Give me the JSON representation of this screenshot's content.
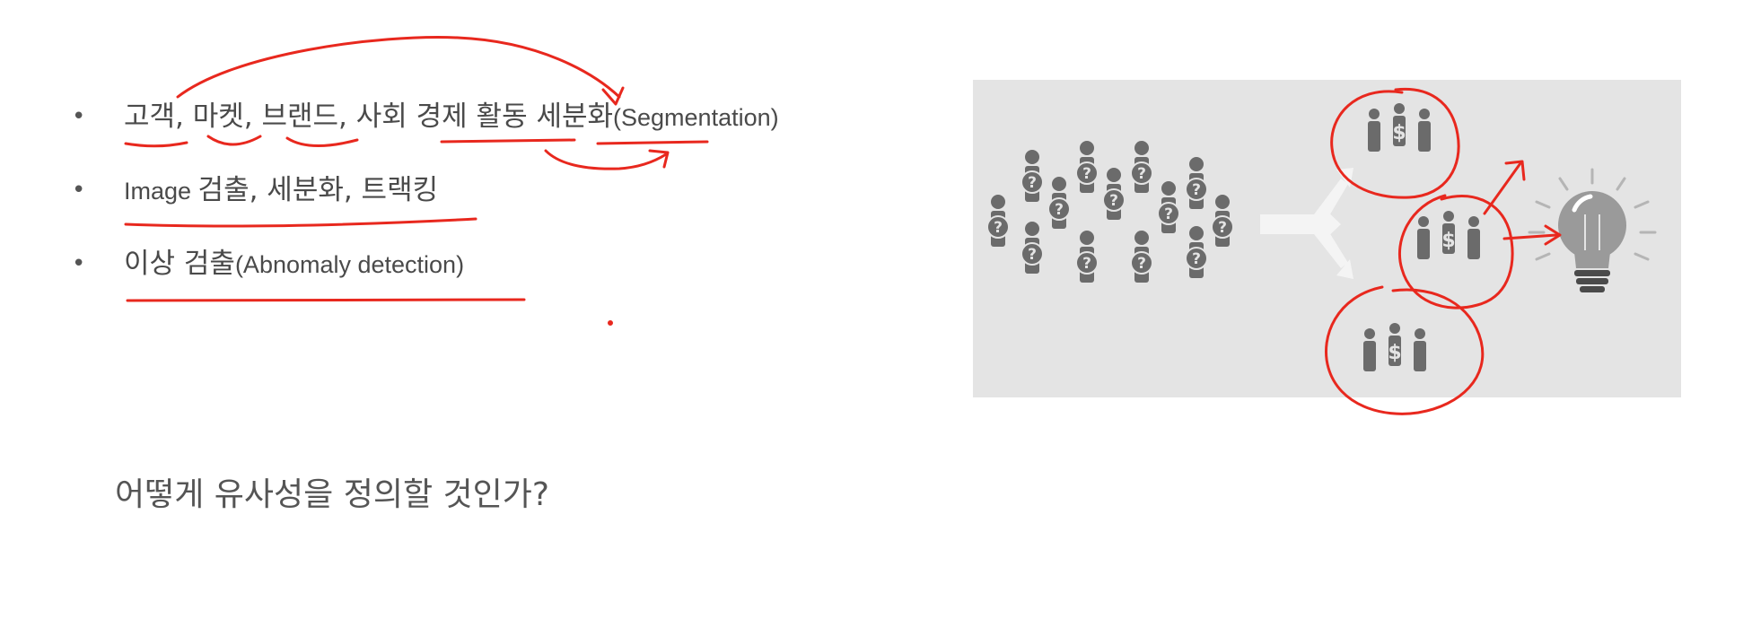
{
  "bullets": [
    {
      "ko": "고객, 마켓, 브랜드, 사회 경제 활동 세분화",
      "en": "(Segmentation)"
    },
    {
      "en": "Image ",
      "ko": "검출, 세분화, 트랙킹"
    },
    {
      "ko": "이상 검출",
      "en": "(Abnomaly detection)"
    }
  ],
  "bullet_marker": "•",
  "question": "어떻게 유사성을 정의할 것인가?",
  "figure": {
    "unknown_person_glyph": "?",
    "group_glyph": "$"
  },
  "colors": {
    "ink": "#e8281e",
    "text": "#4a4a4a",
    "figure_bg": "#e4e4e4",
    "figure_person": "#6b6b6b",
    "bulb": "#9a9a9a"
  }
}
